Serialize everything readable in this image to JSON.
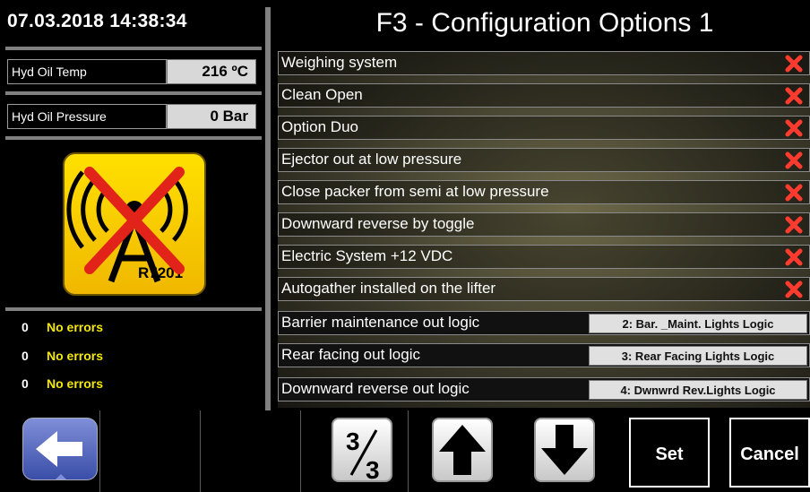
{
  "header": {
    "datetime": "07.03.2018  14:38:34",
    "title": "F3 - Configuration Options 1"
  },
  "readouts": [
    {
      "label": "Hyd Oil Temp",
      "value": "216 ºC"
    },
    {
      "label": "Hyd Oil Pressure",
      "value": "0 Bar"
    }
  ],
  "status_icon": {
    "name": "ar-antenna-disabled-icon",
    "label": "R7201",
    "letter": "A"
  },
  "errors": [
    {
      "count": "0",
      "text": "No errors"
    },
    {
      "count": "0",
      "text": "No errors"
    },
    {
      "count": "0",
      "text": "No errors"
    }
  ],
  "options": [
    {
      "label": "Weighing system",
      "state": "off"
    },
    {
      "label": "Clean Open",
      "state": "off"
    },
    {
      "label": "Option Duo",
      "state": "off"
    },
    {
      "label": "Ejector out at low pressure",
      "state": "off"
    },
    {
      "label": "Close packer from semi at low pressure",
      "state": "off"
    },
    {
      "label": "Downward reverse by toggle",
      "state": "off"
    },
    {
      "label": "Electric System +12 VDC",
      "state": "off"
    },
    {
      "label": "Autogather installed on the lifter",
      "state": "off"
    }
  ],
  "logic_options": [
    {
      "label": "Barrier maintenance out logic",
      "value": "2: Bar. _Maint. Lights Logic"
    },
    {
      "label": "Rear facing out logic",
      "value": "3: Rear Facing Lights Logic"
    },
    {
      "label": "Downward reverse out logic",
      "value": "4: Dwnwrd Rev.Lights Logic"
    }
  ],
  "toolbar": {
    "page_num": "3",
    "page_total": "3",
    "set_label": "Set",
    "cancel_label": "Cancel"
  },
  "colors": {
    "off_mark": "#ff3b2f",
    "accent_yellow": "#f2e800",
    "icon_bg": "#ffd800"
  }
}
